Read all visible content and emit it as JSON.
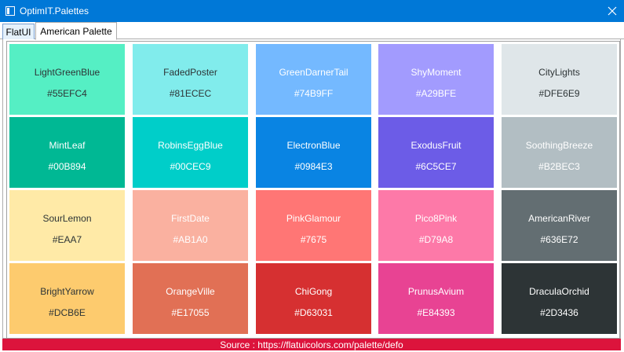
{
  "window": {
    "title": "OptimIT.Palettes",
    "close_icon": "close-icon"
  },
  "tabs": [
    {
      "label": "FlatUI"
    },
    {
      "label": "American Palette",
      "selected": true
    }
  ],
  "swatches": [
    {
      "name": "LightGreenBlue",
      "hex": "#55EFC4",
      "color": "#55EFC4",
      "text_color": "#2d3436"
    },
    {
      "name": "FadedPoster",
      "hex": "#81ECEC",
      "color": "#81ECEC",
      "text_color": "#2d3436"
    },
    {
      "name": "GreenDarnerTail",
      "hex": "#74B9FF",
      "color": "#74B9FF",
      "text_color": "#ffffff"
    },
    {
      "name": "ShyMoment",
      "hex": "#A29BFE",
      "color": "#A29BFE",
      "text_color": "#ffffff"
    },
    {
      "name": "CityLights",
      "hex": "#DFE6E9",
      "color": "#DFE6E9",
      "text_color": "#2d3436"
    },
    {
      "name": "MintLeaf",
      "hex": "#00B894",
      "color": "#00B894",
      "text_color": "#ffffff"
    },
    {
      "name": "RobinsEggBlue",
      "hex": "#00CEC9",
      "color": "#00CEC9",
      "text_color": "#ffffff"
    },
    {
      "name": "ElectronBlue",
      "hex": "#0984E3",
      "color": "#0984E3",
      "text_color": "#ffffff"
    },
    {
      "name": "ExodusFruit",
      "hex": "#6C5CE7",
      "color": "#6C5CE7",
      "text_color": "#ffffff"
    },
    {
      "name": "SoothingBreeze",
      "hex": "#B2BEC3",
      "color": "#B2BEC3",
      "text_color": "#ffffff"
    },
    {
      "name": "SourLemon",
      "hex": "#EAA7",
      "color": "#FFEAA7",
      "text_color": "#2d3436"
    },
    {
      "name": "FirstDate",
      "hex": "#AB1A0",
      "color": "#FAB1A0",
      "text_color": "#ffffff"
    },
    {
      "name": "PinkGlamour",
      "hex": "#7675",
      "color": "#FF7675",
      "text_color": "#ffffff"
    },
    {
      "name": "Pico8Pink",
      "hex": "#D79A8",
      "color": "#FD79A8",
      "text_color": "#ffffff"
    },
    {
      "name": "AmericanRiver",
      "hex": "#636E72",
      "color": "#636E72",
      "text_color": "#ffffff"
    },
    {
      "name": "BrightYarrow",
      "hex": "#DCB6E",
      "color": "#FDCB6E",
      "text_color": "#2d3436"
    },
    {
      "name": "OrangeVille",
      "hex": "#E17055",
      "color": "#E17055",
      "text_color": "#ffffff"
    },
    {
      "name": "ChiGong",
      "hex": "#D63031",
      "color": "#D63031",
      "text_color": "#ffffff"
    },
    {
      "name": "PrunusAvium",
      "hex": "#E84393",
      "color": "#E84393",
      "text_color": "#ffffff"
    },
    {
      "name": "DraculaOrchid",
      "hex": "#2D3436",
      "color": "#2D3436",
      "text_color": "#ffffff"
    }
  ],
  "footer": {
    "text": "Source : https://flatuicolors.com/palette/defo",
    "color": "#DC143C"
  }
}
